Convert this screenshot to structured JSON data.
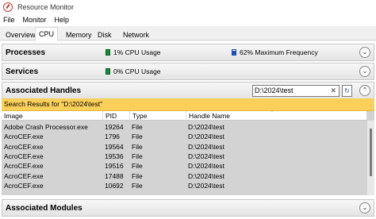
{
  "window": {
    "title": "Resource Monitor"
  },
  "menu": [
    "File",
    "Monitor",
    "Help"
  ],
  "tabs": [
    "Overview",
    "CPU",
    "Memory",
    "Disk",
    "Network"
  ],
  "processes": {
    "title": "Processes",
    "cpu_usage": "1% CPU Usage",
    "max_frequency": "62% Maximum Frequency"
  },
  "services": {
    "title": "Services",
    "cpu_usage": "0% CPU Usage"
  },
  "handles": {
    "title": "Associated Handles",
    "search_value": "D:\\2024\\test",
    "results_label": "Search Results for \"D:\\2024\\test\"",
    "columns": [
      "Image",
      "PID",
      "Type",
      "Handle Name"
    ],
    "rows": [
      [
        "Adobe Crash Processor.exe",
        "19264",
        "File",
        "D:\\2024\\test"
      ],
      [
        "AcroCEF.exe",
        "1796",
        "File",
        "D:\\2024\\test"
      ],
      [
        "AcroCEF.exe",
        "19564",
        "File",
        "D:\\2024\\test"
      ],
      [
        "AcroCEF.exe",
        "19536",
        "File",
        "D:\\2024\\test"
      ],
      [
        "AcroCEF.exe",
        "19516",
        "File",
        "D:\\2024\\test"
      ],
      [
        "AcroCEF.exe",
        "17488",
        "File",
        "D:\\2024\\test"
      ],
      [
        "AcroCEF.exe",
        "10692",
        "File",
        "D:\\2024\\test"
      ]
    ]
  },
  "modules": {
    "title": "Associated Modules"
  },
  "colors": {
    "results_bar": "#fbd05a",
    "cpu_green": "#1b8a3b",
    "freq_blue": "#1f4fb0",
    "grid_bg": "#d3d3d3"
  }
}
